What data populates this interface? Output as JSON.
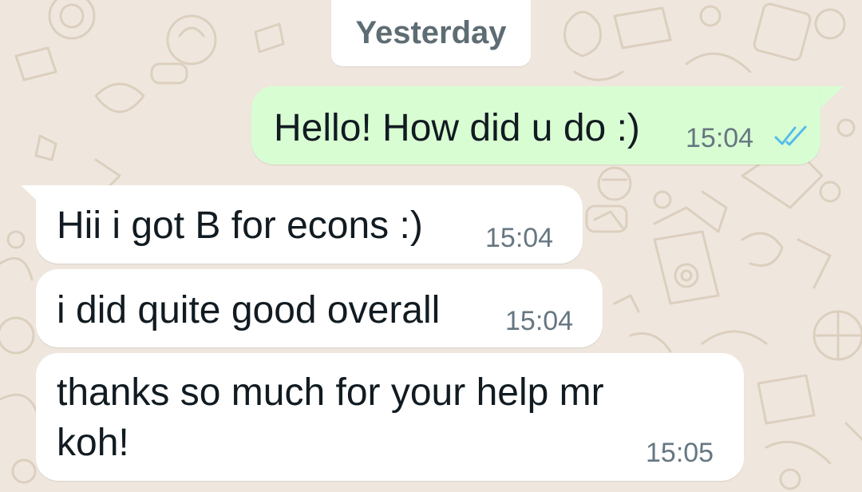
{
  "date_divider": "Yesterday",
  "colors": {
    "background": "#efe7de",
    "outgoing_bubble": "#d9fdd3",
    "incoming_bubble": "#ffffff",
    "read_ticks": "#53bdeb",
    "text": "#111b21",
    "meta": "#667781"
  },
  "messages": [
    {
      "direction": "outgoing",
      "text": "Hello! How did u do :)",
      "time": "15:04",
      "status_icon": "double-check-read-icon"
    },
    {
      "direction": "incoming",
      "text": "Hii i got B for econs :)",
      "time": "15:04"
    },
    {
      "direction": "incoming",
      "text": "i did quite good overall",
      "time": "15:04"
    },
    {
      "direction": "incoming",
      "text_line1": "thanks so much for your help mr",
      "text_line2": "koh!",
      "time": "15:05"
    }
  ]
}
